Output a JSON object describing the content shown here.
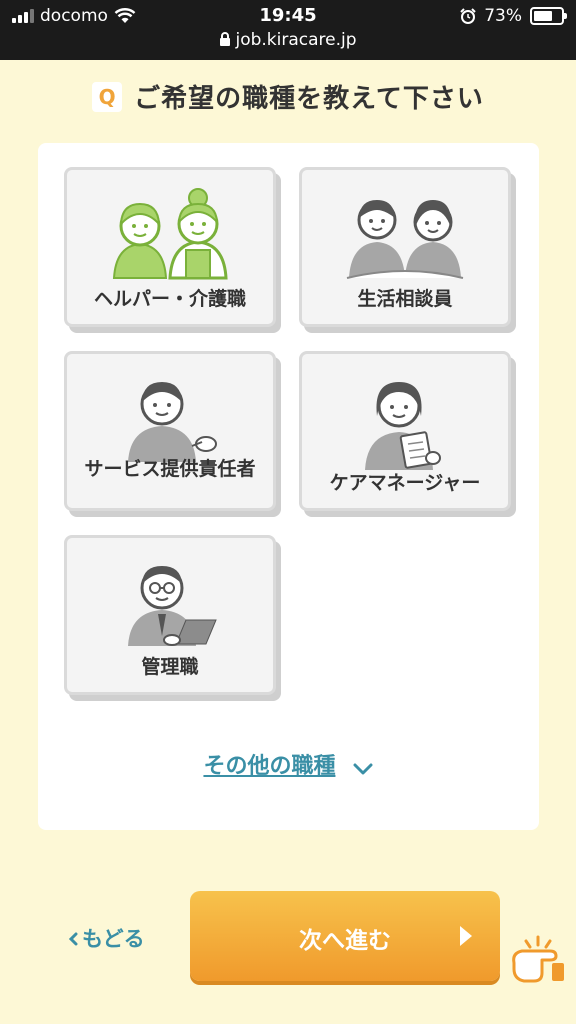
{
  "status_bar": {
    "carrier": "docomo",
    "time": "19:45",
    "url": "job.kiracare.jp",
    "battery": "73%",
    "battery_level": 0.73
  },
  "question": {
    "badge": "Q",
    "text": "ご希望の職種を教えて下さい"
  },
  "options": [
    {
      "label": "ヘルパー・介護職",
      "icon": "helper-caregiver-illustration",
      "selected": true
    },
    {
      "label": "生活相談員",
      "icon": "life-counselor-illustration"
    },
    {
      "label": "サービス提供責任者",
      "icon": "service-manager-illustration"
    },
    {
      "label": "ケアマネージャー",
      "icon": "care-manager-illustration"
    },
    {
      "label": "管理職",
      "icon": "manager-illustration"
    }
  ],
  "other_link": "その他の職種",
  "back_label": "もどる",
  "next_label": "次へ進む",
  "colors": {
    "page_bg": "#fdf8d6",
    "accent_teal": "#3a8fa6",
    "button_orange": "#f4a93a",
    "selected_green": "#8cc63f"
  }
}
